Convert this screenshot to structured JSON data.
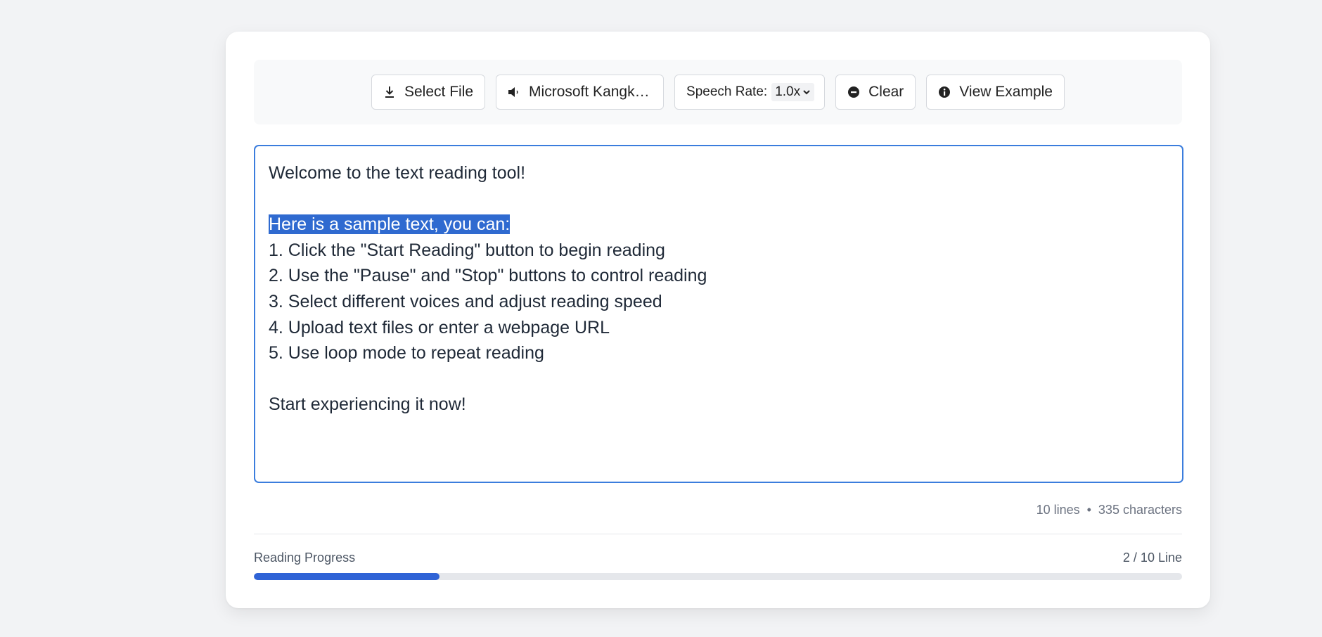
{
  "toolbar": {
    "select_file": {
      "label": "Select File",
      "icon": "download-icon"
    },
    "voice": {
      "label": "Microsoft Kangkang - Chinese (Simplified, PRC)",
      "icon": "speaker-icon"
    },
    "speech_rate": {
      "label": "Speech Rate:",
      "value": "1.0x",
      "icon": "chevron-down-icon"
    },
    "clear": {
      "label": "Clear",
      "icon": "minus-circle-icon"
    },
    "view_example": {
      "label": "View Example",
      "icon": "info-circle-icon"
    }
  },
  "editor": {
    "lines": [
      "Welcome to the text reading tool!",
      "",
      "Here is a sample text, you can:",
      "1. Click the \"Start Reading\" button to begin reading",
      "2. Use the \"Pause\" and \"Stop\" buttons to control reading",
      "3. Select different voices and adjust reading speed",
      "4. Upload text files or enter a webpage URL",
      "5. Use loop mode to repeat reading",
      "",
      "Start experiencing it now!"
    ],
    "highlighted_line_index": 2
  },
  "stats": {
    "lines": "10 lines",
    "separator": "•",
    "characters": "335 characters"
  },
  "progress": {
    "label": "Reading Progress",
    "count": "2 / 10 Line",
    "fraction": 0.2
  },
  "colors": {
    "accent": "#2f63d6",
    "editor_border": "#3b7ddd",
    "highlight": "#2f6ad0",
    "background": "#f2f3f5"
  }
}
